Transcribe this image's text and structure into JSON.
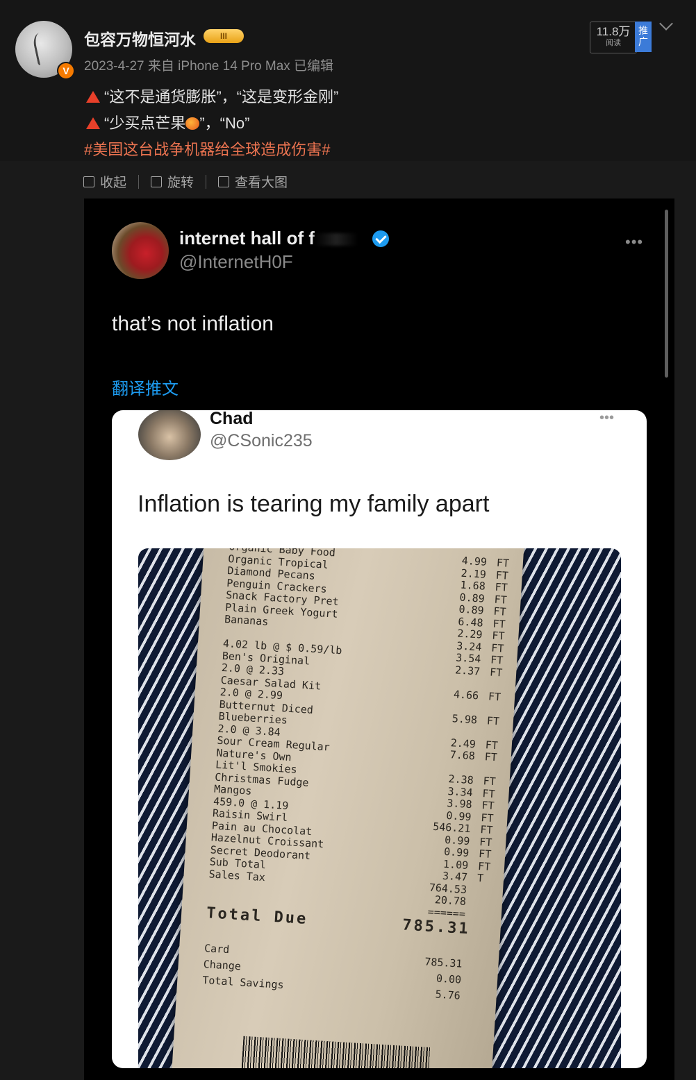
{
  "post": {
    "username": "包容万物恒河水",
    "level_badge": "III",
    "verified_badge": "V",
    "meta": "2023-4-27  来自 iPhone 14 Pro Max 已编辑",
    "reads_count": "11.8万",
    "reads_label": "阅读",
    "promo_label": "推广",
    "line1": "“这不是通货膨胀”，“这是变形金刚”",
    "line2_a": "“少买点芒果",
    "line2_b": "”，“No”",
    "hashtag": "#美国这台战争机器给全球造成伤害#"
  },
  "toolbar": {
    "collapse": "收起",
    "rotate": "旋转",
    "view_large": "查看大图"
  },
  "tweet": {
    "name": "internet hall of f",
    "handle": "@InternetH0F",
    "dots": "•••",
    "text": "that’s not inflation",
    "translate": "翻译推文"
  },
  "quoted": {
    "name": "Chad",
    "handle": "@CSonic235",
    "dots": "•••",
    "text": "Inflation is tearing my family apart"
  },
  "receipt": {
    "lines": [
      {
        "name": "Organic Baby Food",
        "price": "4.99",
        "flag": "FT"
      },
      {
        "name": "Organic Tropical",
        "price": "2.19",
        "flag": "FT"
      },
      {
        "name": "Diamond Pecans",
        "price": "1.68",
        "flag": "FT"
      },
      {
        "name": "Penguin Crackers",
        "price": "0.89",
        "flag": "FT"
      },
      {
        "name": "Snack Factory Pret",
        "price": "0.89",
        "flag": "FT"
      },
      {
        "name": "Plain Greek Yogurt",
        "price": "6.48",
        "flag": "FT"
      },
      {
        "name": "Bananas",
        "price": "2.29",
        "flag": "FT"
      },
      {
        "name": "",
        "price": "3.24",
        "flag": "FT"
      },
      {
        "name": "  4.02 lb @ $ 0.59/lb",
        "price": "3.54",
        "flag": "FT"
      },
      {
        "name": "Ben's Original",
        "price": "2.37",
        "flag": "FT"
      },
      {
        "name": "  2.0 @ 2.33",
        "price": "",
        "flag": ""
      },
      {
        "name": "Caesar Salad Kit",
        "price": "4.66",
        "flag": "FT"
      },
      {
        "name": "  2.0 @ 2.99",
        "price": "",
        "flag": ""
      },
      {
        "name": "Butternut Diced",
        "price": "5.98",
        "flag": "FT"
      },
      {
        "name": "Blueberries",
        "price": "",
        "flag": ""
      },
      {
        "name": "  2.0 @ 3.84",
        "price": "2.49",
        "flag": "FT"
      },
      {
        "name": "Sour Cream Regular",
        "price": "7.68",
        "flag": "FT"
      },
      {
        "name": "Nature's Own",
        "price": "",
        "flag": ""
      },
      {
        "name": "Lit'l Smokies",
        "price": "2.38",
        "flag": "FT"
      },
      {
        "name": "Christmas Fudge",
        "price": "3.34",
        "flag": "FT"
      },
      {
        "name": "Mangos",
        "price": "3.98",
        "flag": "FT"
      },
      {
        "name": "  459.0 @ 1.19",
        "price": "0.99",
        "flag": "FT"
      },
      {
        "name": "Raisin Swirl",
        "price": "546.21",
        "flag": "FT"
      },
      {
        "name": "Pain au Chocolat",
        "price": "0.99",
        "flag": "FT"
      },
      {
        "name": "Hazelnut Croissant",
        "price": "0.99",
        "flag": "FT"
      },
      {
        "name": "Secret Deodorant",
        "price": "1.09",
        "flag": "FT"
      },
      {
        "name": "        Sub Total",
        "price": "3.47",
        "flag": "T"
      },
      {
        "name": "Sales Tax",
        "price": "764.53",
        "flag": ""
      },
      {
        "name": "",
        "price": "20.78",
        "flag": ""
      },
      {
        "name": "",
        "price": "======",
        "flag": ""
      }
    ],
    "total_label": "Total Due",
    "total_value": "785.31",
    "card_label": "Card",
    "card_value": "785.31",
    "change_label": "Change",
    "change_value": "0.00",
    "savings_label": "Total Savings",
    "savings_value": "5.76"
  }
}
